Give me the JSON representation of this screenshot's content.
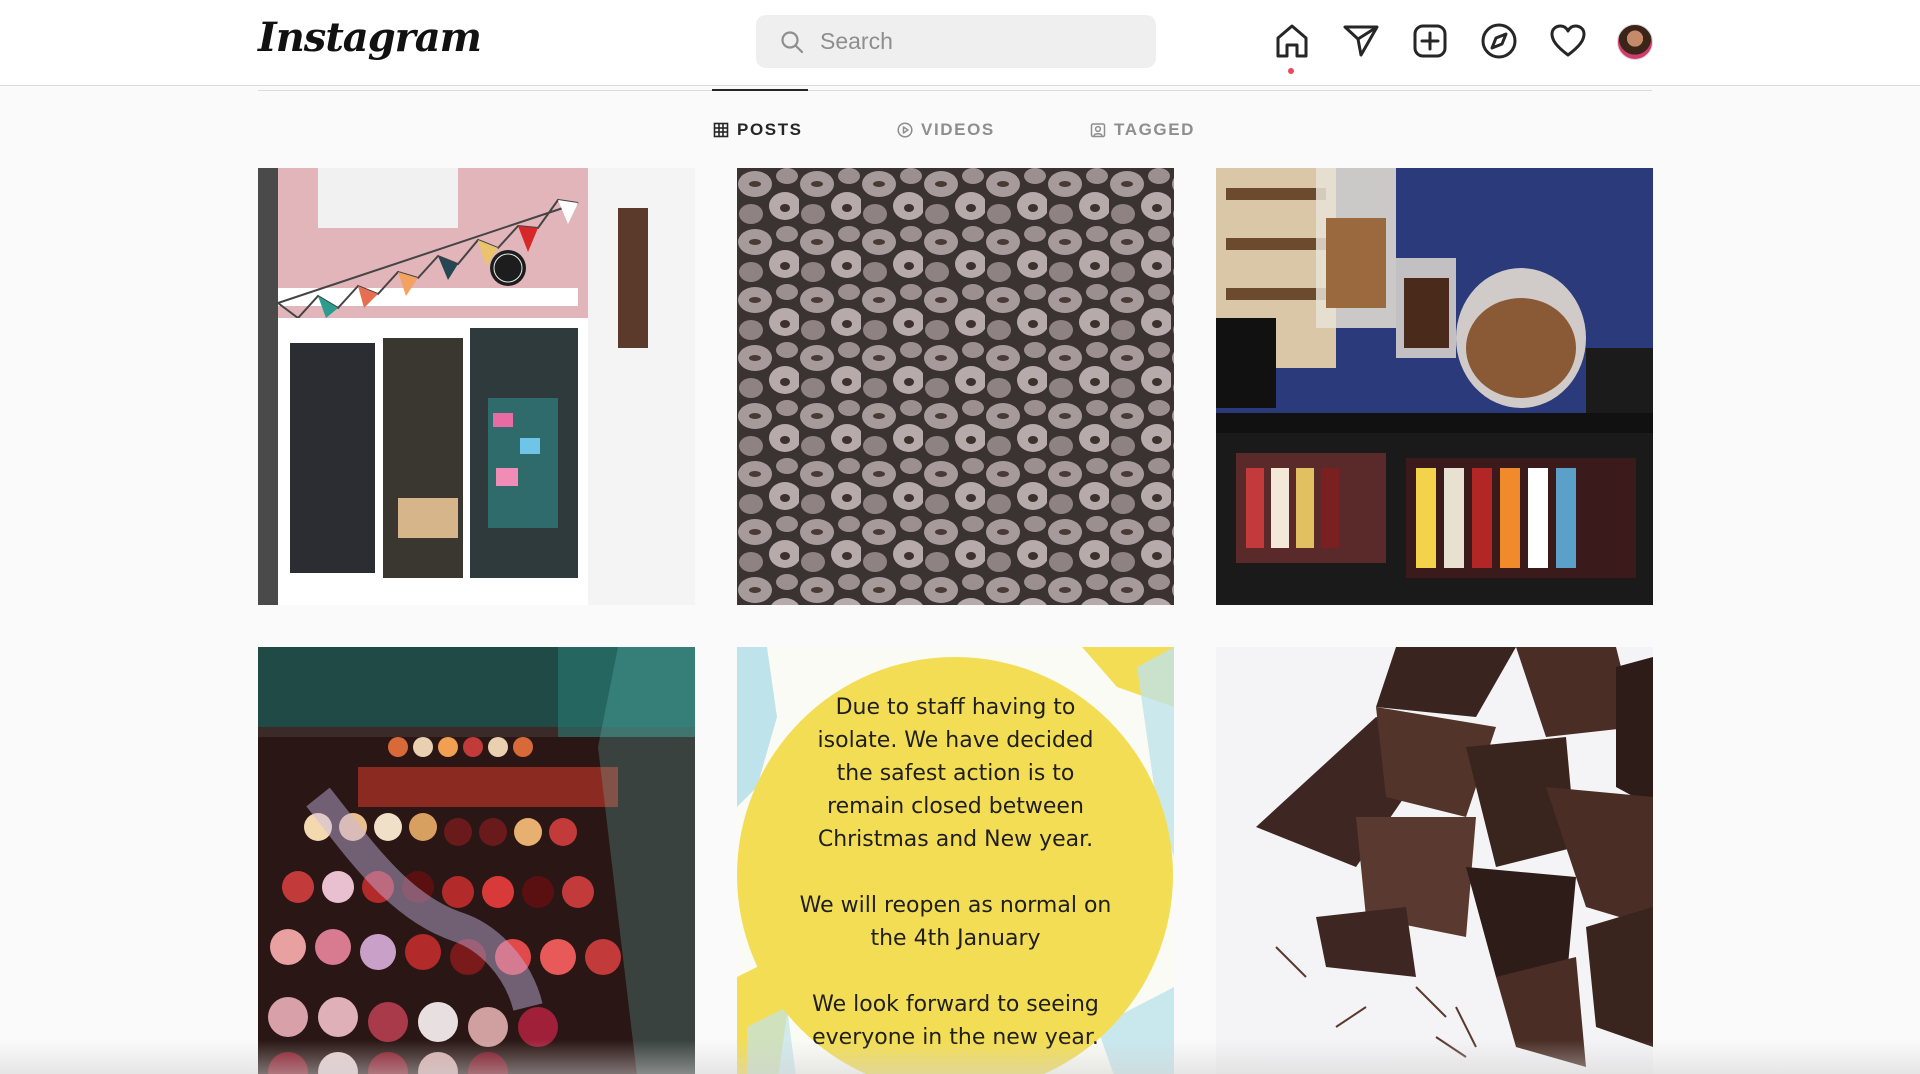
{
  "header": {
    "logo": "Instagram",
    "search_placeholder": "Search",
    "icons": [
      "home-icon",
      "direct-message-icon",
      "new-post-icon",
      "explore-icon",
      "activity-heart-icon",
      "profile-avatar"
    ]
  },
  "tabs": [
    {
      "label": "POSTS",
      "icon": "grid-icon",
      "active": true
    },
    {
      "label": "VIDEOS",
      "icon": "play-circle-icon",
      "active": false
    },
    {
      "label": "TAGGED",
      "icon": "tagged-person-icon",
      "active": false
    }
  ],
  "posts": [
    {
      "subject": "pink shop front with bunting"
    },
    {
      "subject": "pile of chocolate-coated nuggets"
    },
    {
      "subject": "chocolate counter with jars"
    },
    {
      "subject": "display case of bonbons"
    },
    {
      "subject": "closure notice",
      "text": "Due to staff having to\nisolate. We have decided\nthe safest action is to\nremain closed between\nChristmas and New year.\n\nWe will reopen as normal on\nthe 4th January\n\nWe look forward to seeing\neveryone in the new year."
    },
    {
      "subject": "broken chocolate shards"
    }
  ],
  "colors": {
    "accent_notification": "#ed4956",
    "notice_yellow": "#f3dd55",
    "shop_pink": "#e5b8bd"
  }
}
